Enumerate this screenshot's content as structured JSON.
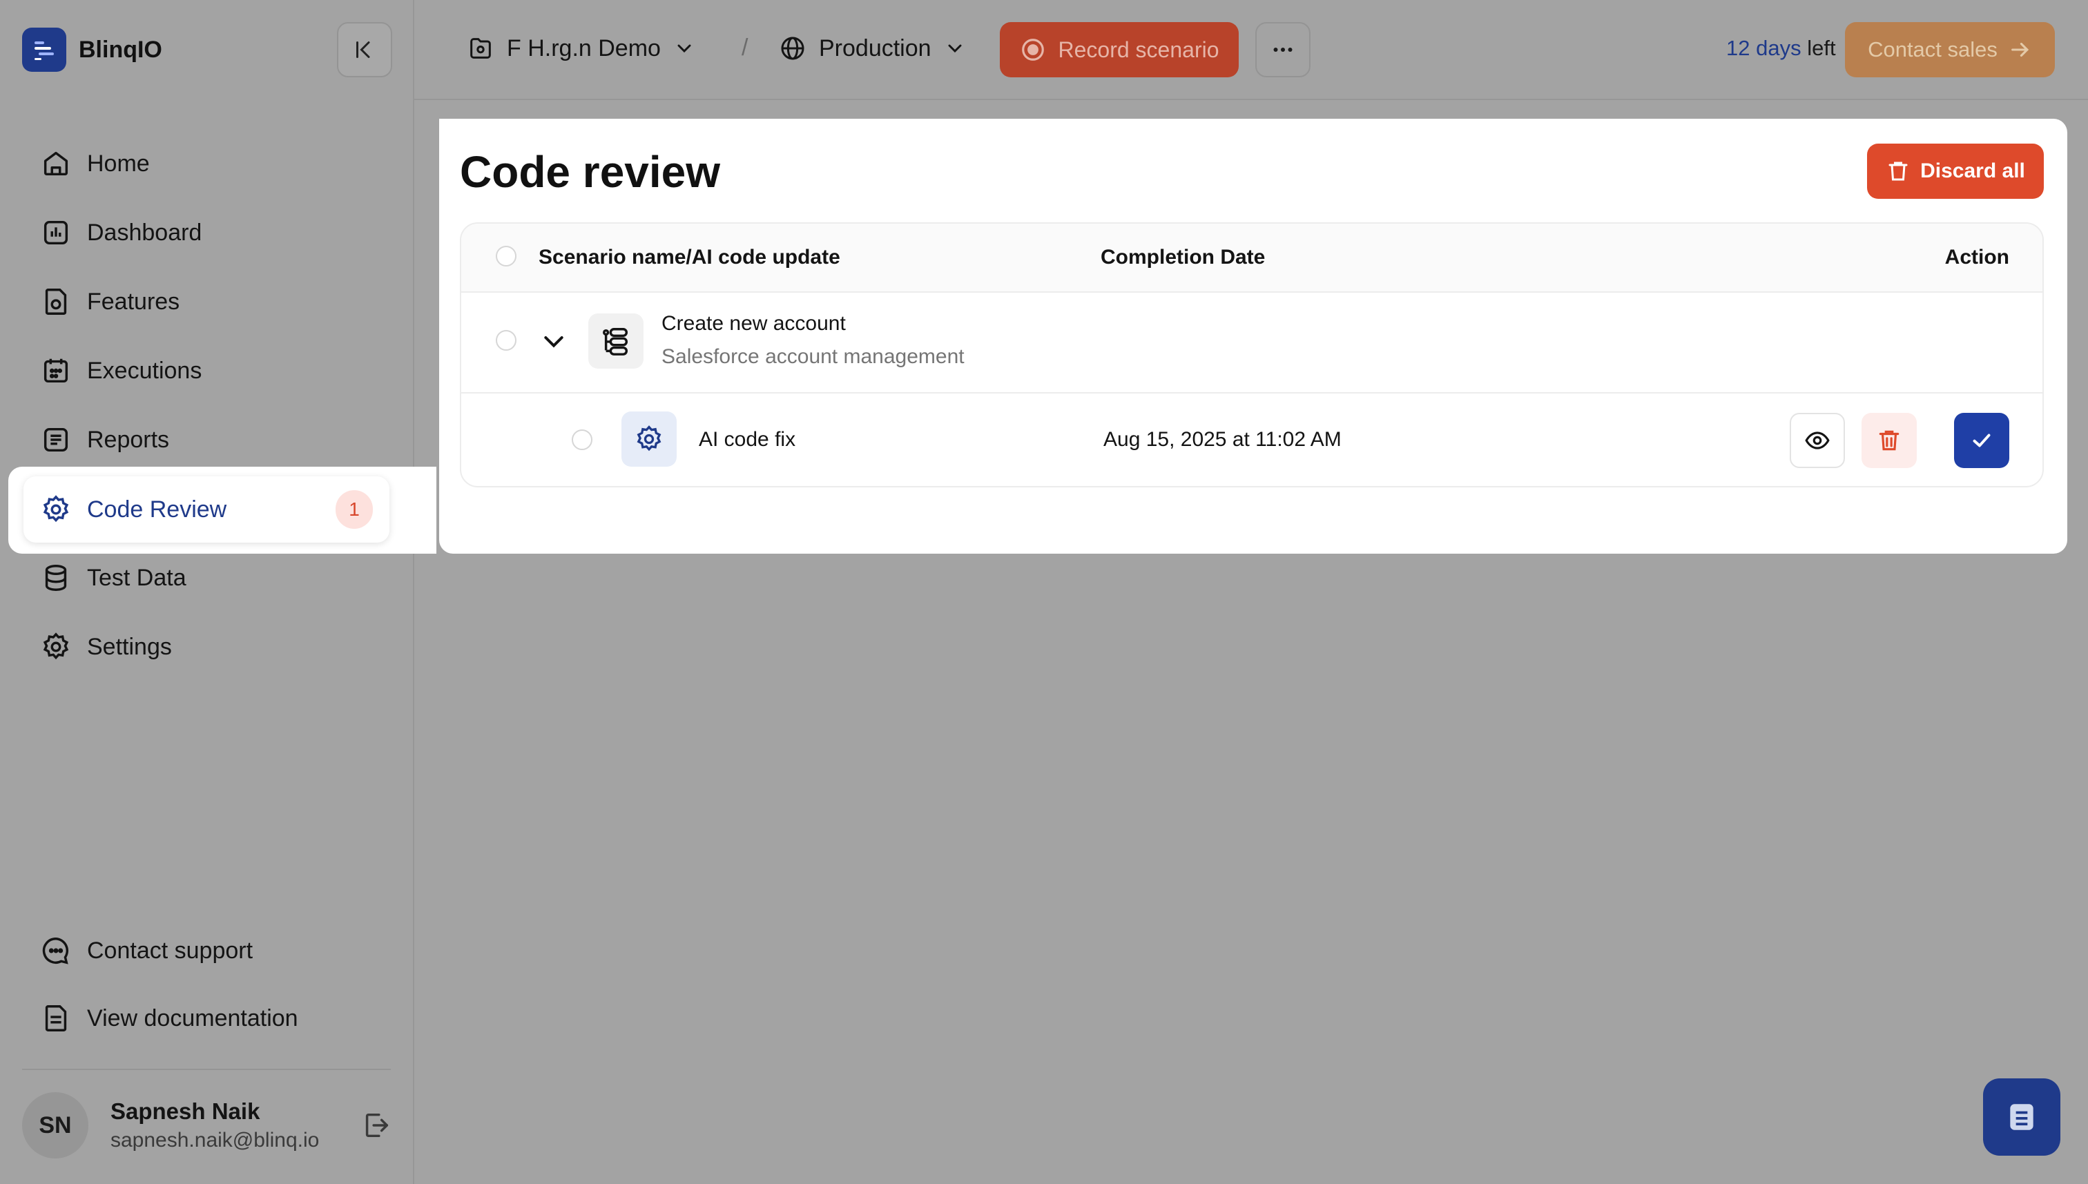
{
  "app": {
    "name": "BlinqIO"
  },
  "topbar": {
    "project": "F H.rg.n Demo",
    "environment": "Production",
    "record_label": "Record scenario",
    "trial_days": "12 days",
    "trial_suffix": "left",
    "contact_sales_label": "Contact sales"
  },
  "sidebar": {
    "items": [
      {
        "label": "Home",
        "icon": "home-icon"
      },
      {
        "label": "Dashboard",
        "icon": "dashboard-icon"
      },
      {
        "label": "Features",
        "icon": "features-icon"
      },
      {
        "label": "Executions",
        "icon": "calendar-icon"
      },
      {
        "label": "Reports",
        "icon": "reports-icon"
      },
      {
        "label": "Code Review",
        "icon": "code-review-icon",
        "active": true,
        "badge": "1"
      },
      {
        "label": "Test Data",
        "icon": "database-icon"
      },
      {
        "label": "Settings",
        "icon": "gear-icon"
      }
    ],
    "footer": [
      {
        "label": "Contact support",
        "icon": "chat-icon"
      },
      {
        "label": "View documentation",
        "icon": "document-icon"
      }
    ],
    "user": {
      "initials": "SN",
      "name": "Sapnesh Naik",
      "email": "sapnesh.naik@blinq.io"
    }
  },
  "main": {
    "title": "Code review",
    "discard_label": "Discard all",
    "columns": [
      "Scenario name/AI code update",
      "Completion Date",
      "Action"
    ],
    "scenario": {
      "name": "Create new account",
      "feature": "Salesforce account management"
    },
    "update": {
      "name": "AI code fix",
      "date": "Aug 15, 2025 at 11:02 AM"
    }
  },
  "colors": {
    "brand": "#1f3a8a",
    "danger": "#de4a2b",
    "contact": "#b9804f"
  }
}
